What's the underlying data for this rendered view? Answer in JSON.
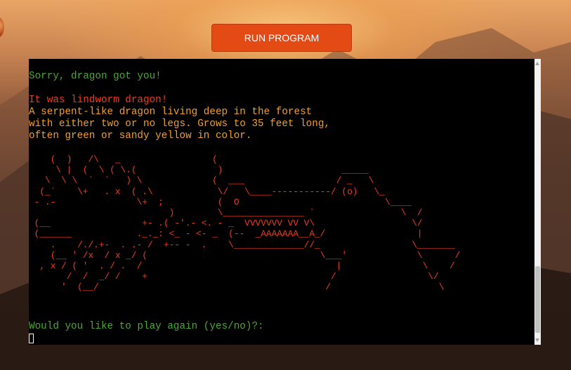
{
  "toolbar": {
    "run_label": "RUN PROGRAM"
  },
  "terminal": {
    "lines": {
      "sorry": "Sorry, dragon got you!",
      "dragon_name": "It was lindworm dragon!",
      "desc1": "A serpent-like dragon living deep in the forest",
      "desc2": "with either two or no legs. Grows to 35 feet long,",
      "desc3": "often green or sandy yellow in color."
    },
    "ascii_art": "    (  )   /\\   _                 (\n     \\ |  (  \\ ( \\.(               )                      _____\n   \\  \\ \\  `  `   ) \\             (  ___                 / _   \\\n  (_`    \\+   . x  ( .\\            \\/   \\____-----------/ (o)   \\_\n - .-               \\+  ;          (  O                           \\____\n                          )        \\_______________ `                \\  /\n (__                 +- .( -'.- <. - _  VVVVVVV VV V\\                  \\/\n (______            ._._: <_ - <- _  (--  _AAAAAAA__A_/                 |\n    .    /./.+-  . .- /  +-- -  .    \\_____________//_                 \\_______\n    (__ ' /x  / x _/ (                                \\___'             \\      /\n  , x / ( '  . / .  /                                    |               \\    /\n       /  /  _/ /    +                                  /                 \\/\n      '  (__/                                          /                    \\",
    "prompt": "Would you like to play again (yes/no)?:"
  },
  "colors": {
    "accent": "#e44a14",
    "terminal_bg": "#000000",
    "text_green": "#4aa834",
    "text_red": "#ef3b1f",
    "text_orange": "#f0a128"
  }
}
